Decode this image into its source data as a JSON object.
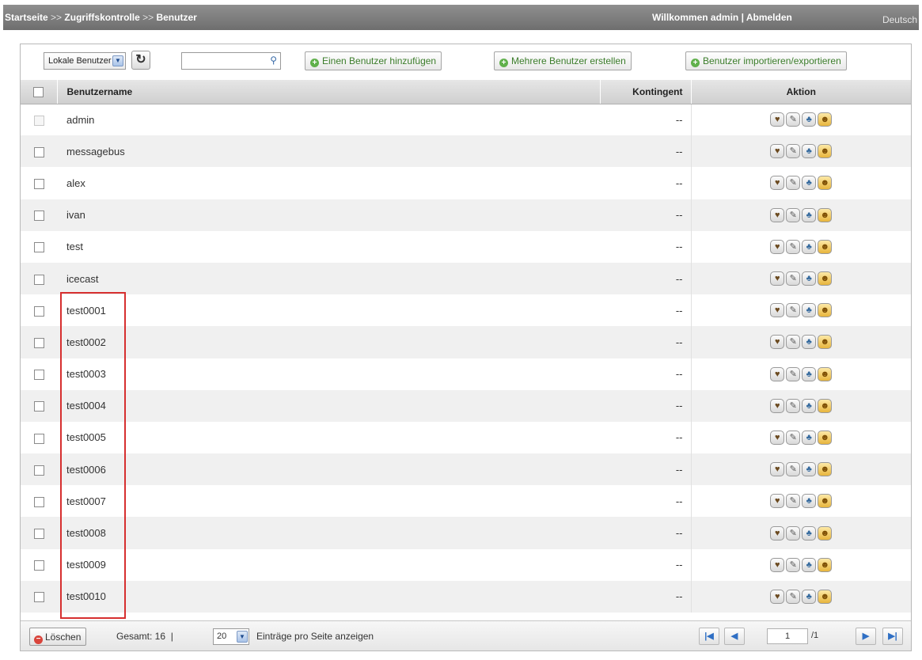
{
  "header": {
    "breadcrumb": [
      "Startseite",
      "Zugriffskontrolle",
      "Benutzer"
    ],
    "breadcrumb_sep": ">>",
    "welcome": "Willkommen admin",
    "divider": "|",
    "logout": "Abmelden",
    "language": "Deutsch"
  },
  "toolbar": {
    "user_type_select": "Lokale Benutzer",
    "search_placeholder": "",
    "add_user": "Einen Benutzer hinzufügen",
    "create_multiple": "Mehrere Benutzer erstellen",
    "import_export": "Benutzer importieren/exportieren"
  },
  "table": {
    "columns": [
      "Benutzername",
      "Kontingent",
      "Aktion"
    ],
    "rows": [
      {
        "name": "admin",
        "quota": "--"
      },
      {
        "name": "messagebus",
        "quota": "--"
      },
      {
        "name": "alex",
        "quota": "--"
      },
      {
        "name": "ivan",
        "quota": "--"
      },
      {
        "name": "test",
        "quota": "--"
      },
      {
        "name": "icecast",
        "quota": "--"
      },
      {
        "name": "test0001",
        "quota": "--"
      },
      {
        "name": "test0002",
        "quota": "--"
      },
      {
        "name": "test0003",
        "quota": "--"
      },
      {
        "name": "test0004",
        "quota": "--"
      },
      {
        "name": "test0005",
        "quota": "--"
      },
      {
        "name": "test0006",
        "quota": "--"
      },
      {
        "name": "test0007",
        "quota": "--"
      },
      {
        "name": "test0008",
        "quota": "--"
      },
      {
        "name": "test0009",
        "quota": "--"
      },
      {
        "name": "test0010",
        "quota": "--"
      }
    ],
    "action_icons": [
      "quota-icon",
      "edit-icon",
      "user-group-icon",
      "share-folder-icon"
    ]
  },
  "footer": {
    "delete": "Löschen",
    "total_label": "Gesamt: 16",
    "divider": "|",
    "per_page_value": "20",
    "per_page_label": "Einträge pro Seite anzeigen",
    "page_current": "1",
    "page_total": "/1"
  },
  "colors": {
    "highlight_box": "#d62f2f",
    "add_button_text": "#3b7d2a"
  }
}
